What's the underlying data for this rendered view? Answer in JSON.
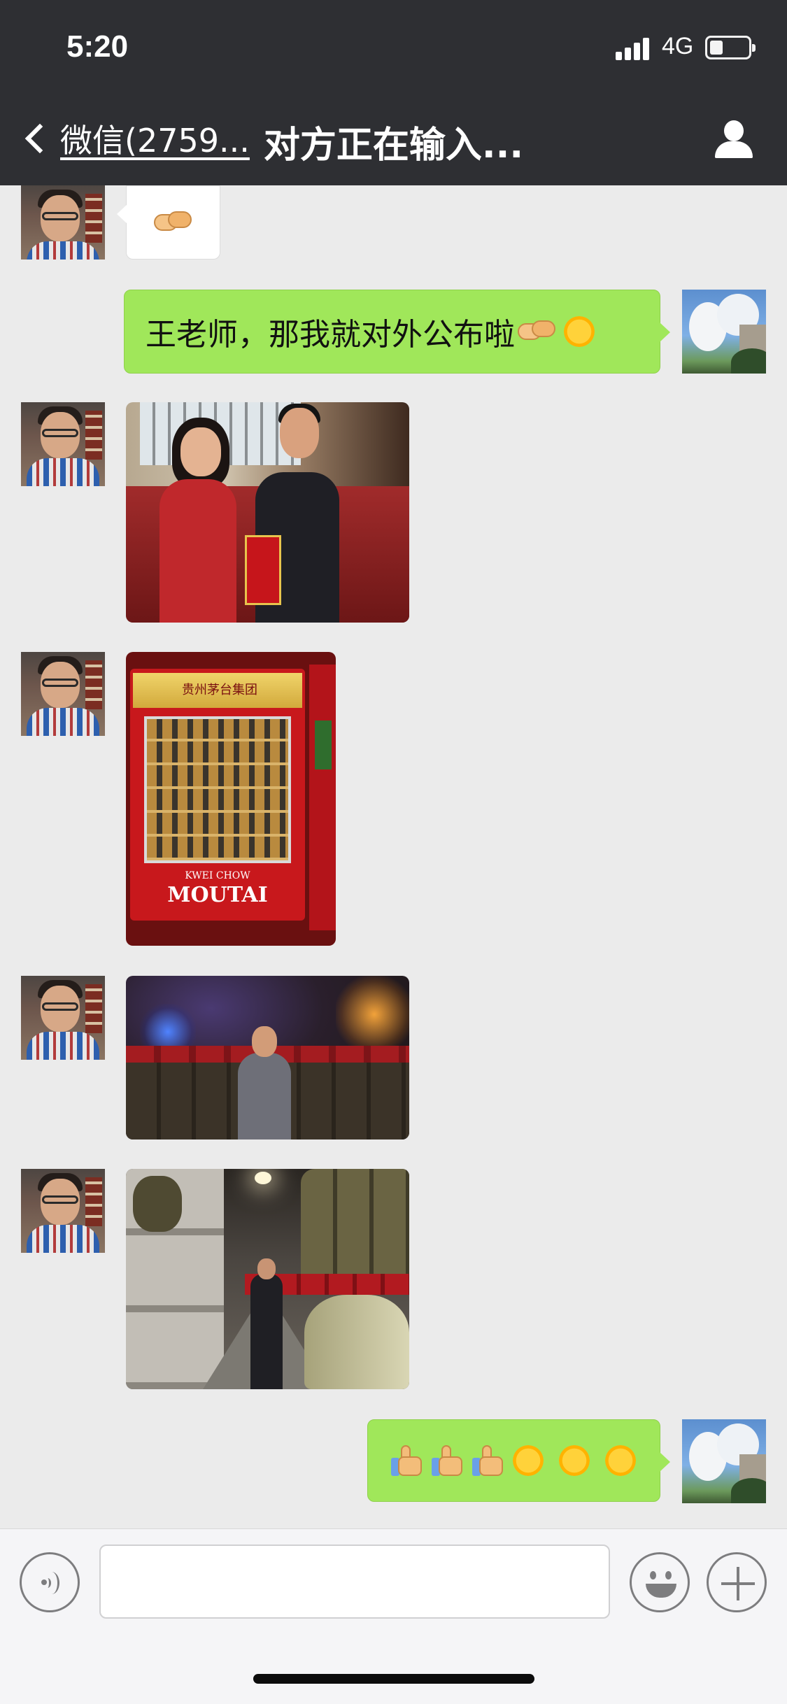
{
  "status_bar": {
    "time": "5:20",
    "network": "4G",
    "battery_level_fraction": 0.3
  },
  "nav": {
    "back_label": "微信(2759...",
    "title": "对方正在输入...",
    "profile_icon": "person-icon"
  },
  "messages": [
    {
      "side": "left",
      "type": "emoji",
      "content": "handshake-emoji"
    },
    {
      "side": "right",
      "type": "text",
      "text": "王老师，那我就对外公布啦",
      "trailing_emojis": [
        "handshake-emoji",
        "sun-emoji"
      ]
    },
    {
      "side": "left",
      "type": "image",
      "image": "photo-couple-with-gift-box"
    },
    {
      "side": "left",
      "type": "image",
      "image": "photo-moutai-vending-machine",
      "printed_text": {
        "brand": "MOUTAI",
        "brand_sub": "KWEI CHOW",
        "header": "贵州茅台集团"
      }
    },
    {
      "side": "left",
      "type": "image",
      "image": "photo-man-in-cave-cellar"
    },
    {
      "side": "left",
      "type": "image",
      "image": "photo-man-in-jar-corridor"
    },
    {
      "side": "right",
      "type": "emoji",
      "content": [
        "thumbs-up-emoji",
        "thumbs-up-emoji",
        "thumbs-up-emoji",
        "sun-emoji",
        "sun-emoji",
        "sun-emoji"
      ]
    }
  ],
  "input_bar": {
    "voice_icon": "voice-icon",
    "input_value": "",
    "emoji_icon": "smiley-icon",
    "more_icon": "plus-icon"
  },
  "colors": {
    "nav_bg": "#2e2f33",
    "chat_bg": "#ebebeb",
    "bubble_green": "#a0e75a",
    "bubble_white": "#ffffff"
  }
}
